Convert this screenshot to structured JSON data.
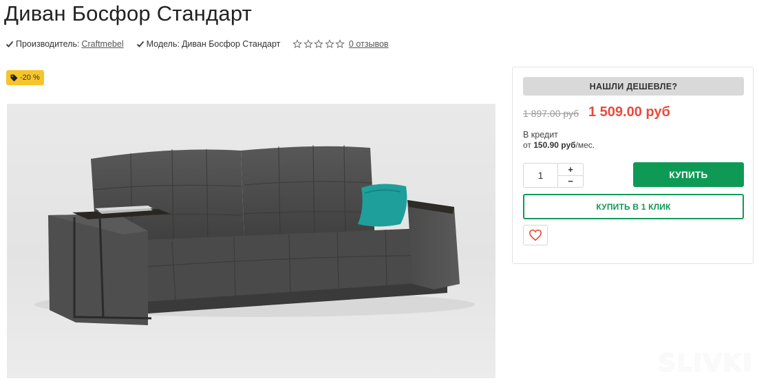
{
  "product": {
    "title": "Диван Босфор Стандарт",
    "manufacturer_label": "Производитель:",
    "manufacturer_value": "Craftmebel",
    "model_label": "Модель:",
    "model_value": "Диван Босфор Стандарт",
    "rating": 0,
    "reviews_link": "0 отзывов",
    "discount_badge": "-20 %"
  },
  "purchase": {
    "cheaper_button": "НАШЛИ ДЕШЕВЛЕ?",
    "old_price": "1 897.00 руб",
    "new_price": "1 509.00 руб",
    "credit_label": "В кредит",
    "credit_prefix": "от",
    "credit_amount": "150.90 руб",
    "credit_suffix": "/мес.",
    "quantity": "1",
    "plus": "+",
    "minus": "−",
    "buy_button": "КУПИТЬ",
    "one_click_button": "КУПИТЬ В 1 КЛИК"
  },
  "watermark": "SLIVKI",
  "colors": {
    "accent_green": "#0e9a55",
    "price_red": "#e84a3c",
    "badge_yellow": "#f7c52b"
  },
  "icons": [
    "check-icon",
    "star-outline-icon",
    "tag-icon",
    "heart-outline-icon"
  ]
}
